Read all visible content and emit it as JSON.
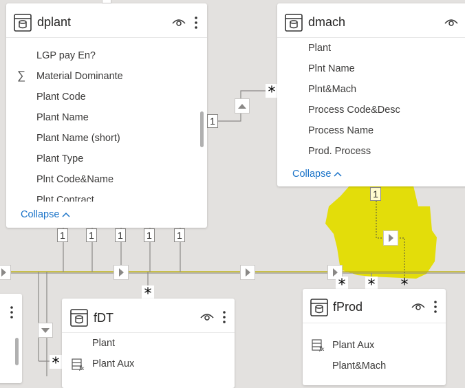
{
  "colors": {
    "canvas": "#e3e1df",
    "highlight": "#e3dd0a",
    "link_blue": "#1a73c8",
    "relationship_line": "#8a8886"
  },
  "tables": {
    "dplant": {
      "title": "dplant",
      "fields": [
        "LGP pay En?",
        "Material Dominante",
        "Plant Code",
        "Plant Name",
        "Plant Name (short)",
        "Plant Type",
        "Plnt Code&Name",
        "Plnt Contract"
      ],
      "collapse": "Collapse"
    },
    "dmach": {
      "title": "dmach",
      "fields": [
        "Plant",
        "Plnt Name",
        "Plnt&Mach",
        "Process Code&Desc",
        "Process Name",
        "Prod. Process"
      ],
      "collapse": "Collapse"
    },
    "fdt": {
      "title": "fDT",
      "fields": [
        "Plant",
        "Plant Aux"
      ]
    },
    "fprod": {
      "title": "fProd",
      "fields": [
        "Plant Aux",
        "Plant&Mach"
      ]
    }
  },
  "cardinality": {
    "one": "1",
    "many": "*"
  },
  "icons": {
    "table": "table-icon",
    "visibility": "eye-icon",
    "more": "more-options-icon",
    "sum": "sigma-icon",
    "calc": "calculated-column-icon"
  }
}
